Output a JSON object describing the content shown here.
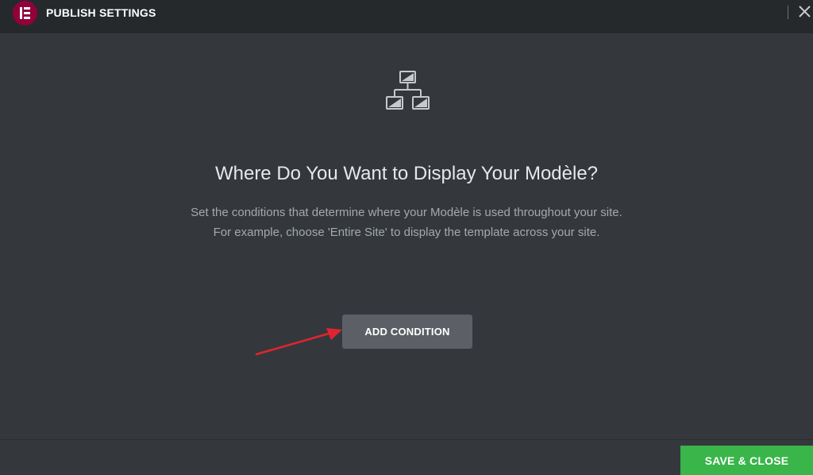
{
  "header": {
    "title": "PUBLISH SETTINGS",
    "logo_icon": "elementor-logo-icon",
    "close_icon": "close-icon"
  },
  "main": {
    "icon": "conditions-hierarchy-icon",
    "title": "Where Do You Want to Display Your Modèle?",
    "description_line1": "Set the conditions that determine where your Modèle is used throughout your site.",
    "description_line2": "For example, choose 'Entire Site' to display the template across your site.",
    "add_condition_label": "ADD CONDITION"
  },
  "footer": {
    "save_close_label": "SAVE & CLOSE"
  },
  "colors": {
    "background": "#34383c",
    "header": "#26292c",
    "brand": "#92003b",
    "button": "#5c6066",
    "save": "#39b54a",
    "annotation_arrow": "#e0242f"
  }
}
